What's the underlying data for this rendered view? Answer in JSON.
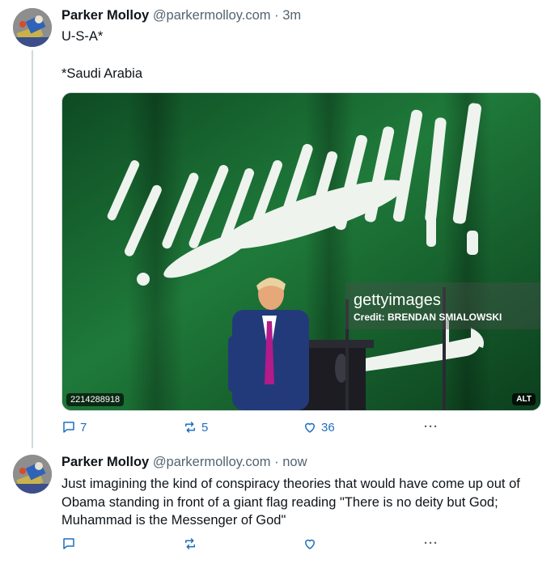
{
  "posts": [
    {
      "author": "Parker Molloy",
      "handle": "@parkermolloy.com",
      "separator": "·",
      "time": "3m",
      "text_lines": [
        "U-S-A*",
        "",
        "*Saudi Arabia"
      ],
      "image": {
        "id_label": "2214288918",
        "alt_badge": "ALT",
        "watermark_brand": "gettyimages",
        "watermark_credit": "Credit: BRENDAN SMIALOWSKI",
        "flag_color": "#1f7a3a"
      },
      "actions": {
        "replies": "7",
        "reposts": "5",
        "likes": "36",
        "more": "···"
      }
    },
    {
      "author": "Parker Molloy",
      "handle": "@parkermolloy.com",
      "separator": "·",
      "time": "now",
      "text": "Just imagining the kind of conspiracy theories that would have come up out of Obama standing in front of a giant flag reading \"There is no deity but God; Muhammad is the Messenger of God\"",
      "actions": {
        "replies": "",
        "reposts": "",
        "likes": "",
        "more": "···"
      }
    }
  ],
  "icons": {
    "reply": "speech-bubble-icon",
    "repost": "repost-arrows-icon",
    "like": "heart-outline-icon",
    "more": "ellipsis-icon"
  },
  "colors": {
    "action_blue": "#1d6fc2",
    "muted": "#536471",
    "thread_line": "#cfd9de"
  }
}
